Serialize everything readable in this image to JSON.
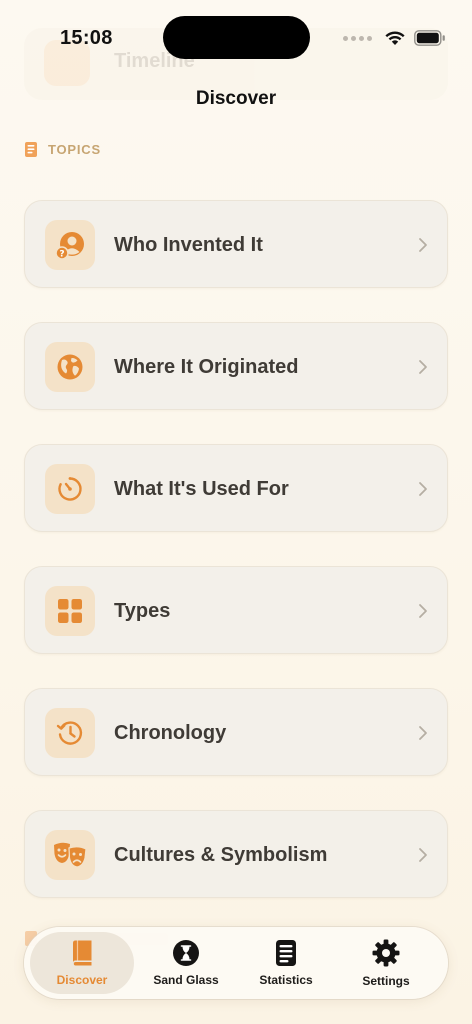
{
  "status_bar": {
    "time": "15:08"
  },
  "ghost_row": {
    "label": "Timeline"
  },
  "header": {
    "title": "Discover"
  },
  "section": {
    "label": "TOPICS"
  },
  "topics": [
    {
      "label": "Who Invented It",
      "icon": "person-question-icon"
    },
    {
      "label": "Where It Originated",
      "icon": "globe-icon"
    },
    {
      "label": "What It's Used For",
      "icon": "timer-icon"
    },
    {
      "label": "Types",
      "icon": "grid-icon"
    },
    {
      "label": "Chronology",
      "icon": "history-clock-icon"
    },
    {
      "label": "Cultures & Symbolism",
      "icon": "theater-masks-icon"
    }
  ],
  "tabs": [
    {
      "label": "Discover",
      "icon": "book-icon",
      "active": true
    },
    {
      "label": "Sand Glass",
      "icon": "hourglass-icon",
      "active": false
    },
    {
      "label": "Statistics",
      "icon": "list-doc-icon",
      "active": false
    },
    {
      "label": "Settings",
      "icon": "gear-icon",
      "active": false
    }
  ],
  "colors": {
    "accent": "#e58a34",
    "icon_bg": "#f4e2c8",
    "section_label": "#c7a572",
    "card_bg": "#f2efe9"
  }
}
